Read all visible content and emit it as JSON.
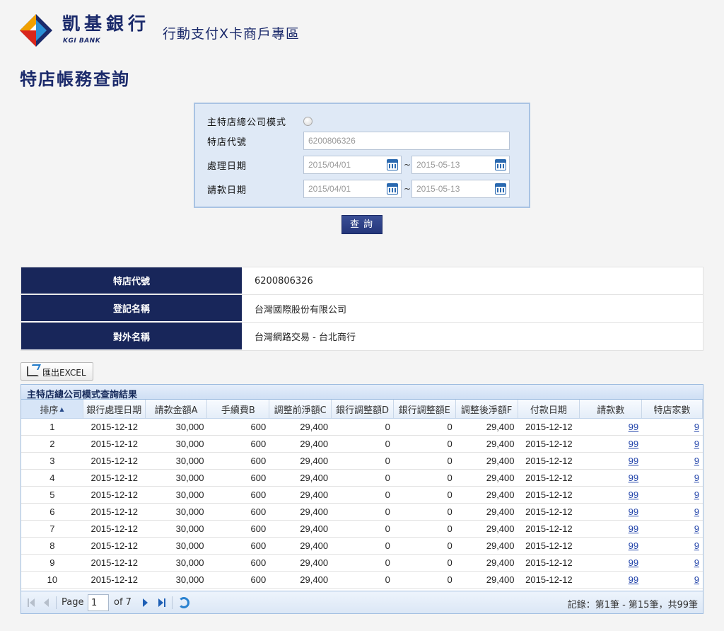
{
  "header": {
    "bank_name": "凱基銀行",
    "bank_name_en": "KGI BANK",
    "subtitle": "行動支付X卡商戶專區"
  },
  "page_title": "特店帳務查詢",
  "search": {
    "mode_label": "主特店總公司模式",
    "merchant_id_label": "特店代號",
    "merchant_id_value": "6200806326",
    "process_date_label": "處理日期",
    "process_date_from": "2015/04/01",
    "process_date_to": "2015-05-13",
    "request_date_label": "請款日期",
    "request_date_from": "2015/04/01",
    "request_date_to": "2015-05-13",
    "range_sep": "~",
    "query_label": "查詢"
  },
  "info": [
    {
      "key": "特店代號",
      "value": "6200806326"
    },
    {
      "key": "登記名稱",
      "value": "台灣國際股份有限公司"
    },
    {
      "key": "對外名稱",
      "value": "台灣網路交易 - 台北商行"
    }
  ],
  "export_label": "匯出EXCEL",
  "grid": {
    "caption": "主特店總公司模式查詢結果",
    "columns": [
      "排序",
      "銀行處理日期",
      "請款金額A",
      "手續費B",
      "調整前淨額C",
      "銀行調整額D",
      "銀行調整額E",
      "調整後淨額F",
      "付款日期",
      "請款數",
      "特店家數"
    ],
    "rows": [
      [
        "1",
        "2015-12-12",
        "30,000",
        "600",
        "29,400",
        "0",
        "0",
        "29,400",
        "2015-12-12",
        "99",
        "9"
      ],
      [
        "2",
        "2015-12-12",
        "30,000",
        "600",
        "29,400",
        "0",
        "0",
        "29,400",
        "2015-12-12",
        "99",
        "9"
      ],
      [
        "3",
        "2015-12-12",
        "30,000",
        "600",
        "29,400",
        "0",
        "0",
        "29,400",
        "2015-12-12",
        "99",
        "9"
      ],
      [
        "4",
        "2015-12-12",
        "30,000",
        "600",
        "29,400",
        "0",
        "0",
        "29,400",
        "2015-12-12",
        "99",
        "9"
      ],
      [
        "5",
        "2015-12-12",
        "30,000",
        "600",
        "29,400",
        "0",
        "0",
        "29,400",
        "2015-12-12",
        "99",
        "9"
      ],
      [
        "6",
        "2015-12-12",
        "30,000",
        "600",
        "29,400",
        "0",
        "0",
        "29,400",
        "2015-12-12",
        "99",
        "9"
      ],
      [
        "7",
        "2015-12-12",
        "30,000",
        "600",
        "29,400",
        "0",
        "0",
        "29,400",
        "2015-12-12",
        "99",
        "9"
      ],
      [
        "8",
        "2015-12-12",
        "30,000",
        "600",
        "29,400",
        "0",
        "0",
        "29,400",
        "2015-12-12",
        "99",
        "9"
      ],
      [
        "9",
        "2015-12-12",
        "30,000",
        "600",
        "29,400",
        "0",
        "0",
        "29,400",
        "2015-12-12",
        "99",
        "9"
      ],
      [
        "10",
        "2015-12-12",
        "30,000",
        "600",
        "29,400",
        "0",
        "0",
        "29,400",
        "2015-12-12",
        "99",
        "9"
      ]
    ]
  },
  "pager": {
    "page_label": "Page",
    "page_value": "1",
    "of_label": "of 7",
    "records_text": "記錄：第1筆 - 第15筆，共99筆"
  },
  "colors": {
    "brand_navy": "#1b2a6b",
    "header_cell_bg": "#18265a",
    "link": "#2244aa"
  }
}
